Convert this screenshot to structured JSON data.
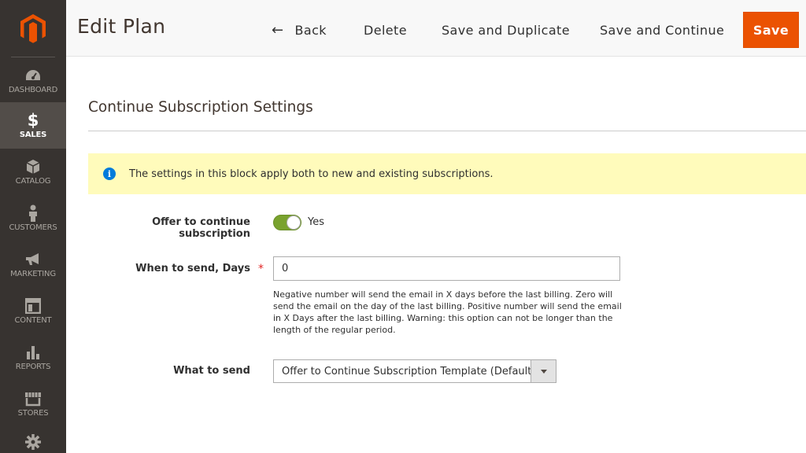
{
  "sidebar": {
    "logo_icon": "magento-logo-icon",
    "items": [
      {
        "label": "Dashboard",
        "icon": "dashboard-icon",
        "active": false
      },
      {
        "label": "Sales",
        "icon": "dollar-icon",
        "active": true
      },
      {
        "label": "Catalog",
        "icon": "cube-icon",
        "active": false
      },
      {
        "label": "Customers",
        "icon": "person-icon",
        "active": false
      },
      {
        "label": "Marketing",
        "icon": "megaphone-icon",
        "active": false
      },
      {
        "label": "Content",
        "icon": "layout-icon",
        "active": false
      },
      {
        "label": "Reports",
        "icon": "bar-chart-icon",
        "active": false
      },
      {
        "label": "Stores",
        "icon": "store-icon",
        "active": false
      },
      {
        "label": "",
        "icon": "gear-icon",
        "active": false
      }
    ]
  },
  "header": {
    "title": "Edit Plan",
    "back_label": "Back",
    "delete_label": "Delete",
    "save_duplicate_label": "Save and Duplicate",
    "save_continue_label": "Save and Continue",
    "save_label": "Save"
  },
  "section": {
    "title": "Continue Subscription Settings",
    "notice": "The settings in this block apply both to new and existing subscriptions."
  },
  "fields": {
    "offer": {
      "label": "Offer to continue subscription",
      "toggle_on": true,
      "value_text": "Yes"
    },
    "when": {
      "label": "When to send, Days",
      "required": true,
      "value": "0",
      "note": "Negative number will send the email in X days before the last billing. Zero will send the email on the day of the last billing. Positive number will send the email in X Days after the last billing. Warning: this option can not be longer than the length of the regular period."
    },
    "what": {
      "label": "What to send",
      "selected": "Offer to Continue Subscription Template (Default)"
    }
  },
  "colors": {
    "sidebar_bg": "#373330",
    "sidebar_active": "#524d49",
    "primary_button": "#eb5202",
    "logo": "#eb5202",
    "toggle_on": "#79a22e",
    "notice_bg": "#fffbbb",
    "info_icon": "#007bdb",
    "required": "#e22626"
  }
}
